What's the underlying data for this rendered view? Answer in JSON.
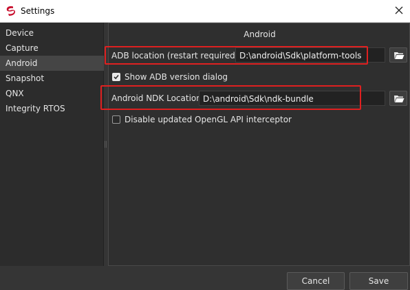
{
  "window": {
    "title": "Settings",
    "logo_icon": "app-logo-icon",
    "close_icon": "close-icon"
  },
  "sidebar": {
    "items": [
      {
        "label": "Device",
        "selected": false
      },
      {
        "label": "Capture",
        "selected": false
      },
      {
        "label": "Android",
        "selected": true
      },
      {
        "label": "Snapshot",
        "selected": false
      },
      {
        "label": "QNX",
        "selected": false
      },
      {
        "label": "Integrity RTOS",
        "selected": false
      }
    ]
  },
  "panel": {
    "title": "Android",
    "adb": {
      "label": "ADB location (restart required)",
      "value": "D:\\android\\Sdk\\platform-tools",
      "browse_icon": "folder-icon"
    },
    "show_adb_dialog": {
      "label": "Show ADB version dialog",
      "checked": true
    },
    "ndk": {
      "label": "Android NDK Location",
      "value": "D:\\android\\Sdk\\ndk-bundle",
      "browse_icon": "folder-icon"
    },
    "disable_opengl": {
      "label": "Disable updated OpenGL API interceptor",
      "checked": false
    }
  },
  "footer": {
    "cancel_label": "Cancel",
    "save_label": "Save"
  },
  "colors": {
    "highlight": "#e02020",
    "panel_bg": "#2f2f2f",
    "sidebar_bg": "#2c2c2c",
    "selected_item": "#454545"
  }
}
